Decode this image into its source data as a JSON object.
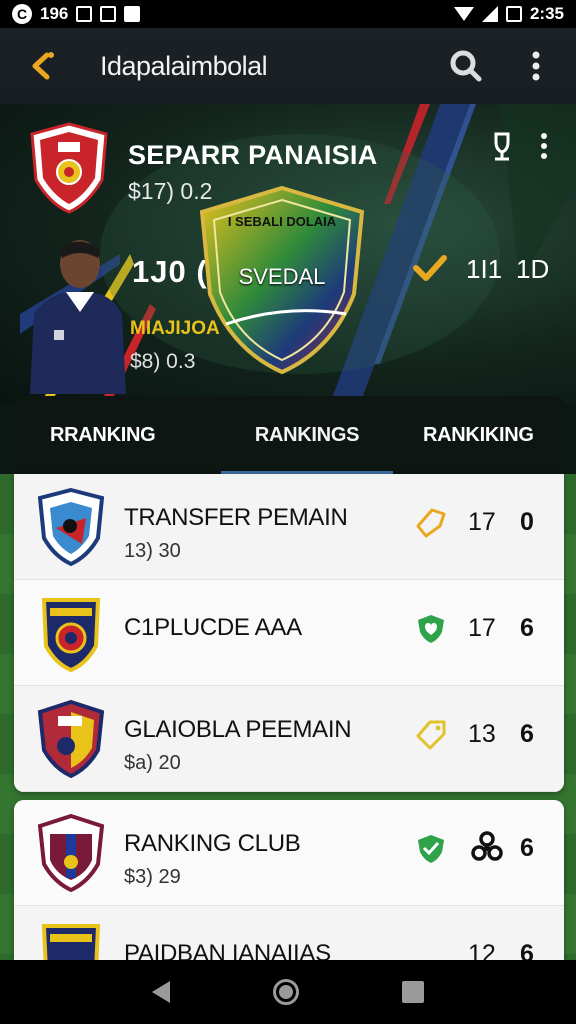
{
  "status_bar": {
    "carrier": "C",
    "time_left": "196",
    "time": "2:35"
  },
  "app_bar": {
    "title": "Idapalaimbolal",
    "back_icon": "chevron-left-icon",
    "search_icon": "search-icon",
    "menu_icon": "more-vert-icon",
    "accent_color": "#e9a820"
  },
  "hero": {
    "club_name": "SEPARR PANAISIA",
    "club_price": "$17) 0.2",
    "score": "1J0 (",
    "player_name": "MIAJIJOA",
    "player_price": "$8) 0.3",
    "shield_top": "I SEBALI DOLAIA",
    "shield_label": "SVEDAL",
    "stat_1": "1I1",
    "stat_2": "1D"
  },
  "tabs": [
    {
      "label": "RRANKING",
      "active": false
    },
    {
      "label": "RANKINGS",
      "active": true
    },
    {
      "label": "RANKIKING",
      "active": false
    }
  ],
  "list": [
    {
      "name": "TRANSFER PEMAIN",
      "price": "13) 30",
      "stat": "17",
      "stat2": "0",
      "status": "tag-outline-icon",
      "status_color": "#e9a820"
    },
    {
      "name": "C1PLUCDE AAA",
      "price": "",
      "stat": "17",
      "stat2": "6",
      "status": "heart-shield-icon",
      "status_color": "#2ea34a"
    },
    {
      "name": "GLAIOBLA PEEMAIN",
      "price": "$a) 20",
      "stat": "13",
      "stat2": "6",
      "status": "tag-outline-icon",
      "status_color": "#e0c22a"
    },
    {
      "name": "RANKING CLUB",
      "price": "$3) 29",
      "stat": "",
      "stat2": "6",
      "status": "check-shield-icon",
      "status_color": "#2ea34a",
      "icon2": "biohazard-icon"
    },
    {
      "name": "PAIDBAN IANAIIAS",
      "price": "",
      "stat": "12",
      "stat2": "6",
      "status": "",
      "status_color": ""
    }
  ],
  "nav_bar": {
    "back": "nav-back-icon",
    "home": "nav-home-icon",
    "recents": "nav-recents-icon"
  }
}
